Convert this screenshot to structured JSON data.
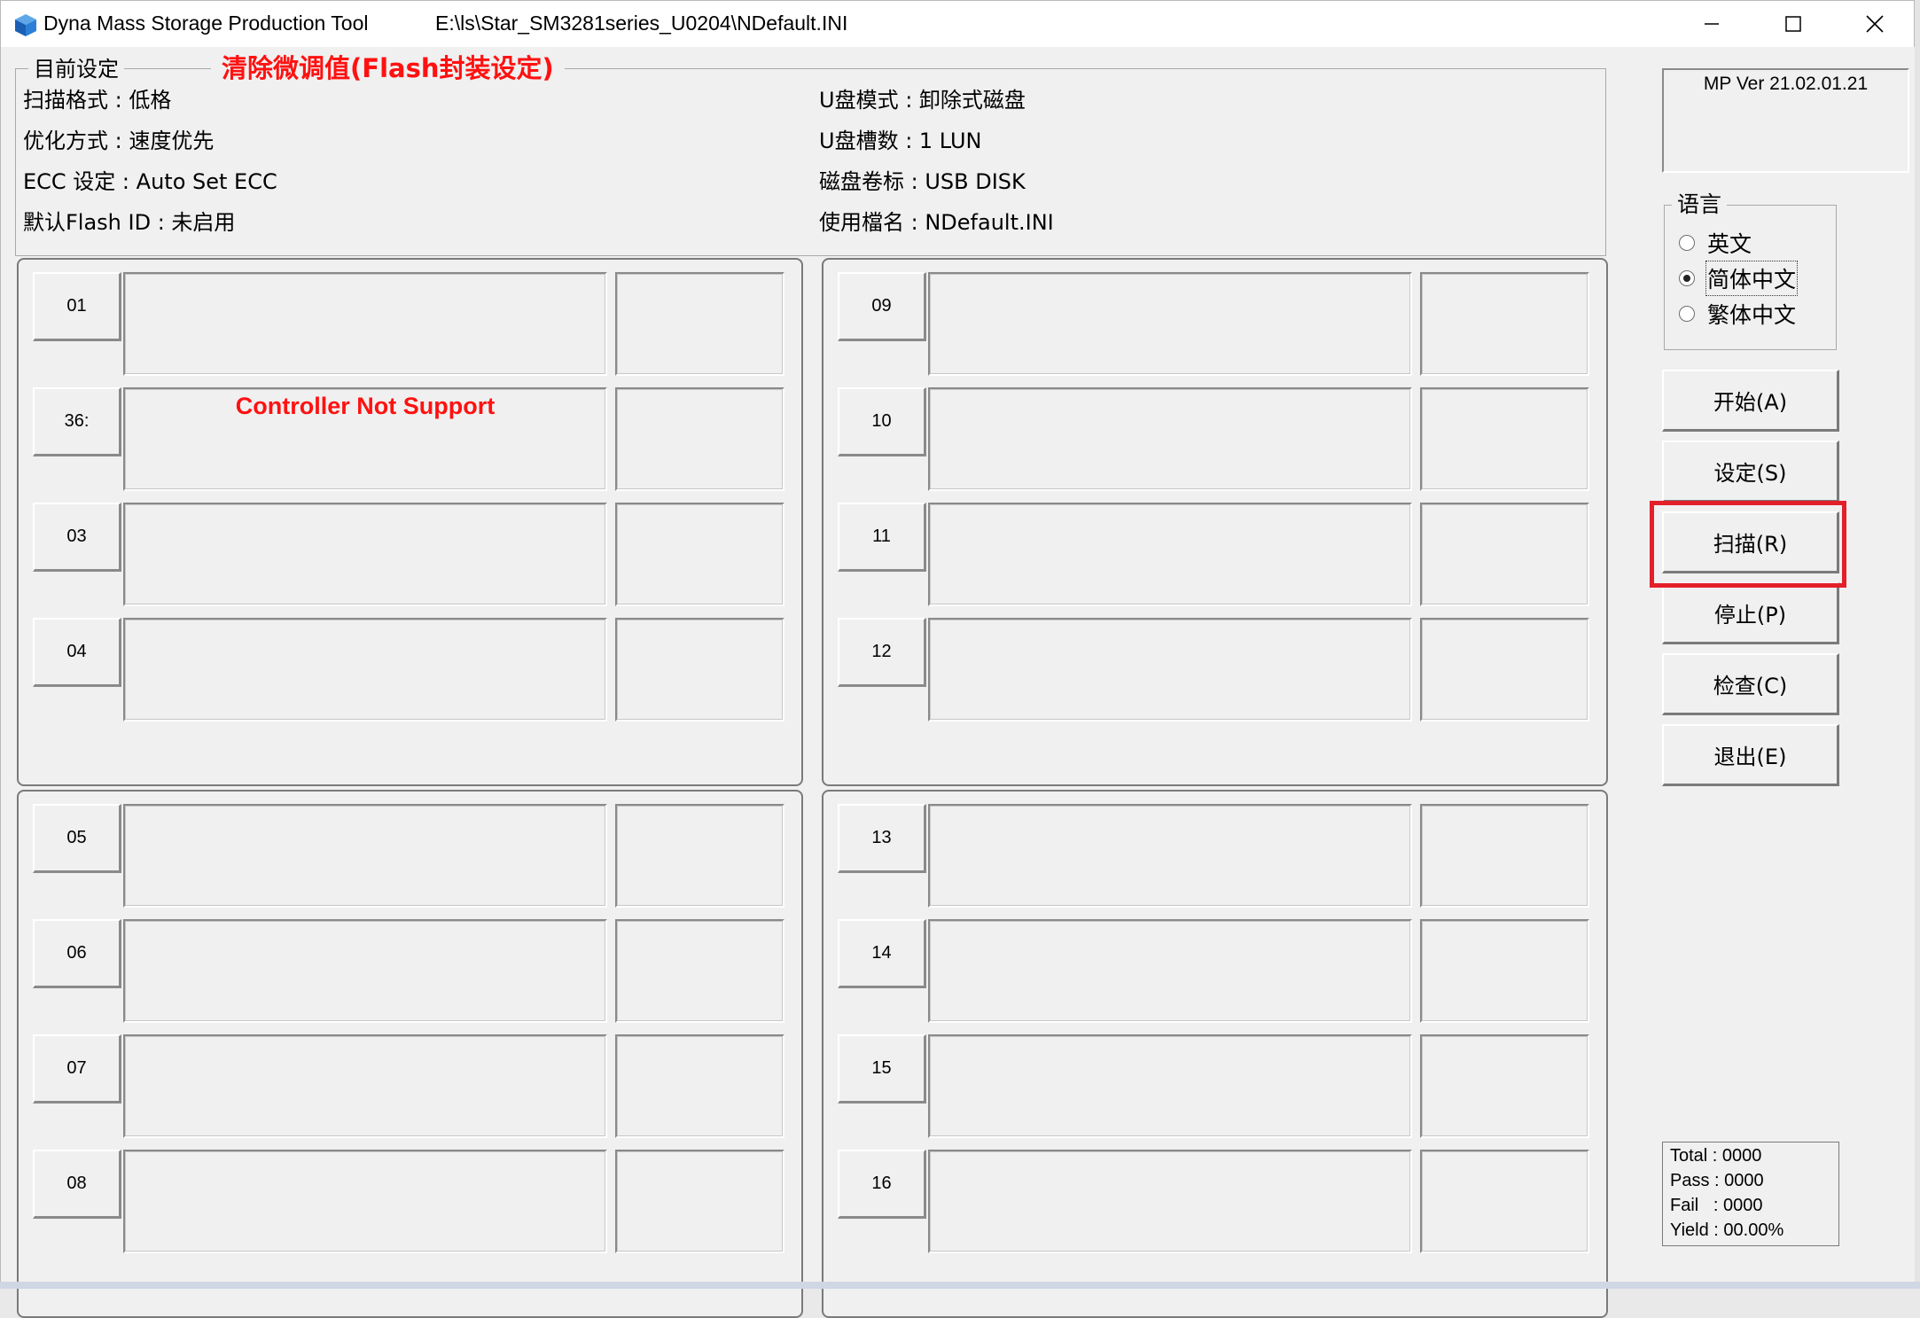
{
  "window": {
    "title": "Dyna Mass Storage Production Tool",
    "path": "E:\\ls\\Star_SM3281series_U0204\\NDefault.INI",
    "controls": [
      "minimize-icon",
      "maximize-icon",
      "close-icon"
    ]
  },
  "settings": {
    "legend": "目前设定",
    "notice": "清除微调值(Flash封装设定)",
    "left": [
      "扫描格式 : 低格",
      "优化方式 : 速度优先",
      "ECC 设定 : Auto Set ECC",
      "默认Flash ID : 未启用"
    ],
    "right": [
      "U盘模式 : 卸除式磁盘",
      "U盘槽数 : 1 LUN",
      "磁盘卷标 : USB DISK",
      "使用檔名 : NDefault.INI"
    ]
  },
  "ports": [
    {
      "label": "01",
      "message": ""
    },
    {
      "label": "36:",
      "message": "Controller Not Support"
    },
    {
      "label": "03",
      "message": ""
    },
    {
      "label": "04",
      "message": ""
    },
    {
      "label": "09",
      "message": ""
    },
    {
      "label": "10",
      "message": ""
    },
    {
      "label": "11",
      "message": ""
    },
    {
      "label": "12",
      "message": ""
    },
    {
      "label": "05",
      "message": ""
    },
    {
      "label": "06",
      "message": ""
    },
    {
      "label": "07",
      "message": ""
    },
    {
      "label": "08",
      "message": ""
    },
    {
      "label": "13",
      "message": ""
    },
    {
      "label": "14",
      "message": ""
    },
    {
      "label": "15",
      "message": ""
    },
    {
      "label": "16",
      "message": ""
    }
  ],
  "version": "MP Ver 21.02.01.21",
  "language": {
    "legend": "语言",
    "options": [
      "英文",
      "简体中文",
      "繁体中文"
    ],
    "selected": "简体中文"
  },
  "buttons": {
    "start": "开始(A)",
    "settings": "设定(S)",
    "scan": "扫描(R)",
    "stop": "停止(P)",
    "check": "检查(C)",
    "exit": "退出(E)"
  },
  "stats": {
    "total": "Total : 0000",
    "pass": "Pass : 0000",
    "fail": "Fail   : 0000",
    "yield": "Yield : 00.00%"
  },
  "colors": {
    "notice": "#ff1111",
    "highlight": "#e3202a",
    "background": "#f0f0f0"
  }
}
